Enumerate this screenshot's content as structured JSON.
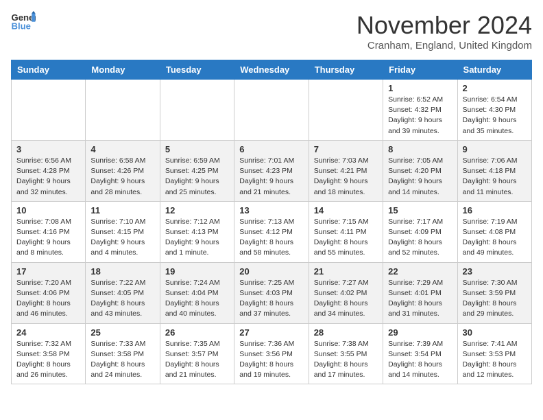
{
  "header": {
    "logo_general": "General",
    "logo_blue": "Blue",
    "month": "November 2024",
    "location": "Cranham, England, United Kingdom"
  },
  "days_of_week": [
    "Sunday",
    "Monday",
    "Tuesday",
    "Wednesday",
    "Thursday",
    "Friday",
    "Saturday"
  ],
  "weeks": [
    [
      {
        "day": "",
        "info": ""
      },
      {
        "day": "",
        "info": ""
      },
      {
        "day": "",
        "info": ""
      },
      {
        "day": "",
        "info": ""
      },
      {
        "day": "",
        "info": ""
      },
      {
        "day": "1",
        "info": "Sunrise: 6:52 AM\nSunset: 4:32 PM\nDaylight: 9 hours and 39 minutes."
      },
      {
        "day": "2",
        "info": "Sunrise: 6:54 AM\nSunset: 4:30 PM\nDaylight: 9 hours and 35 minutes."
      }
    ],
    [
      {
        "day": "3",
        "info": "Sunrise: 6:56 AM\nSunset: 4:28 PM\nDaylight: 9 hours and 32 minutes."
      },
      {
        "day": "4",
        "info": "Sunrise: 6:58 AM\nSunset: 4:26 PM\nDaylight: 9 hours and 28 minutes."
      },
      {
        "day": "5",
        "info": "Sunrise: 6:59 AM\nSunset: 4:25 PM\nDaylight: 9 hours and 25 minutes."
      },
      {
        "day": "6",
        "info": "Sunrise: 7:01 AM\nSunset: 4:23 PM\nDaylight: 9 hours and 21 minutes."
      },
      {
        "day": "7",
        "info": "Sunrise: 7:03 AM\nSunset: 4:21 PM\nDaylight: 9 hours and 18 minutes."
      },
      {
        "day": "8",
        "info": "Sunrise: 7:05 AM\nSunset: 4:20 PM\nDaylight: 9 hours and 14 minutes."
      },
      {
        "day": "9",
        "info": "Sunrise: 7:06 AM\nSunset: 4:18 PM\nDaylight: 9 hours and 11 minutes."
      }
    ],
    [
      {
        "day": "10",
        "info": "Sunrise: 7:08 AM\nSunset: 4:16 PM\nDaylight: 9 hours and 8 minutes."
      },
      {
        "day": "11",
        "info": "Sunrise: 7:10 AM\nSunset: 4:15 PM\nDaylight: 9 hours and 4 minutes."
      },
      {
        "day": "12",
        "info": "Sunrise: 7:12 AM\nSunset: 4:13 PM\nDaylight: 9 hours and 1 minute."
      },
      {
        "day": "13",
        "info": "Sunrise: 7:13 AM\nSunset: 4:12 PM\nDaylight: 8 hours and 58 minutes."
      },
      {
        "day": "14",
        "info": "Sunrise: 7:15 AM\nSunset: 4:11 PM\nDaylight: 8 hours and 55 minutes."
      },
      {
        "day": "15",
        "info": "Sunrise: 7:17 AM\nSunset: 4:09 PM\nDaylight: 8 hours and 52 minutes."
      },
      {
        "day": "16",
        "info": "Sunrise: 7:19 AM\nSunset: 4:08 PM\nDaylight: 8 hours and 49 minutes."
      }
    ],
    [
      {
        "day": "17",
        "info": "Sunrise: 7:20 AM\nSunset: 4:06 PM\nDaylight: 8 hours and 46 minutes."
      },
      {
        "day": "18",
        "info": "Sunrise: 7:22 AM\nSunset: 4:05 PM\nDaylight: 8 hours and 43 minutes."
      },
      {
        "day": "19",
        "info": "Sunrise: 7:24 AM\nSunset: 4:04 PM\nDaylight: 8 hours and 40 minutes."
      },
      {
        "day": "20",
        "info": "Sunrise: 7:25 AM\nSunset: 4:03 PM\nDaylight: 8 hours and 37 minutes."
      },
      {
        "day": "21",
        "info": "Sunrise: 7:27 AM\nSunset: 4:02 PM\nDaylight: 8 hours and 34 minutes."
      },
      {
        "day": "22",
        "info": "Sunrise: 7:29 AM\nSunset: 4:01 PM\nDaylight: 8 hours and 31 minutes."
      },
      {
        "day": "23",
        "info": "Sunrise: 7:30 AM\nSunset: 3:59 PM\nDaylight: 8 hours and 29 minutes."
      }
    ],
    [
      {
        "day": "24",
        "info": "Sunrise: 7:32 AM\nSunset: 3:58 PM\nDaylight: 8 hours and 26 minutes."
      },
      {
        "day": "25",
        "info": "Sunrise: 7:33 AM\nSunset: 3:58 PM\nDaylight: 8 hours and 24 minutes."
      },
      {
        "day": "26",
        "info": "Sunrise: 7:35 AM\nSunset: 3:57 PM\nDaylight: 8 hours and 21 minutes."
      },
      {
        "day": "27",
        "info": "Sunrise: 7:36 AM\nSunset: 3:56 PM\nDaylight: 8 hours and 19 minutes."
      },
      {
        "day": "28",
        "info": "Sunrise: 7:38 AM\nSunset: 3:55 PM\nDaylight: 8 hours and 17 minutes."
      },
      {
        "day": "29",
        "info": "Sunrise: 7:39 AM\nSunset: 3:54 PM\nDaylight: 8 hours and 14 minutes."
      },
      {
        "day": "30",
        "info": "Sunrise: 7:41 AM\nSunset: 3:53 PM\nDaylight: 8 hours and 12 minutes."
      }
    ]
  ]
}
